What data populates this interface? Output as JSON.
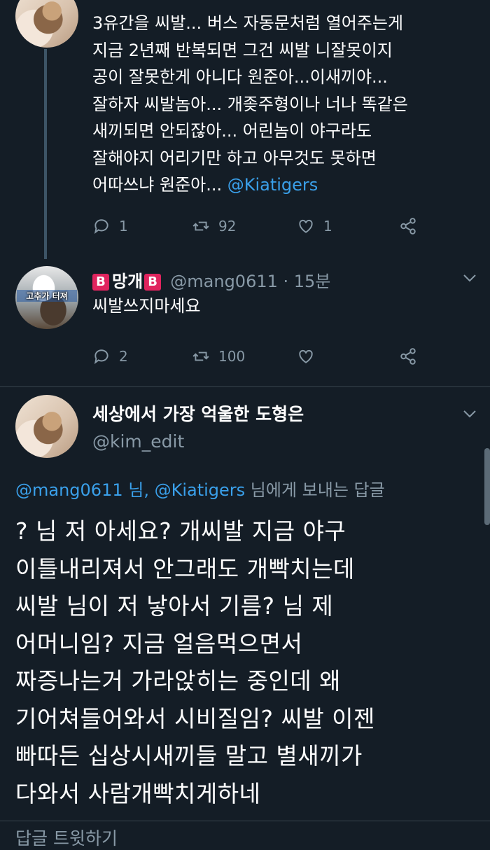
{
  "tweet1": {
    "lines": [
      "3유간을 씨발... 버스 자동문처럼 열어주는게",
      "지금 2년째 반복되면 그건 씨발 니잘못이지",
      "공이 잘못한게 아니다 원준아...이새끼야...",
      "잘하자 씨발놈아... 개좆주형이나 너나 똑같은",
      "새끼되면 안되잖아... 어린놈이 야구라도",
      "잘해야지 어리기만 하고 아무것도 못하면"
    ],
    "last_line_text": "어따쓰냐 원준아... ",
    "last_line_mention": "@Kiatigers",
    "replies": "1",
    "retweets": "92",
    "likes": "1"
  },
  "tweet2": {
    "avatar_text": "고추가 터져",
    "badge_left": "B",
    "display_name": "망개",
    "badge_right": "B",
    "handle_time": "@mang0611 · 15분",
    "text": "씨발쓰지마세요",
    "replies": "2",
    "retweets": "100"
  },
  "main": {
    "display_name": "세상에서 가장 억울한 도형은",
    "handle": "@kim_edit",
    "reply_to_mention1": "@mang0611 님,",
    "reply_to_mention2": "@Kiatigers",
    "reply_to_suffix": " 님에게 보내는 답글",
    "lines": [
      "? 님 저 아세요? 개씨발 지금 야구",
      "이틀내리져서 안그래도 개빡치는데",
      "씨발 님이 저 낳아서 기름? 님 제",
      "어머니임? 지금 얼음먹으면서",
      "짜증나는거 가라앉히는 중인데 왜",
      "기어쳐들어와서 시비질임? 씨발 이젠",
      "빠따든 십상시새끼들 말고 별새끼가",
      "다와서 사람개빡치게하네"
    ]
  },
  "reply_bar": {
    "placeholder": "답글 트윗하기"
  },
  "colors": {
    "background": "#141d26",
    "link": "#3aa0ea",
    "muted": "#8899a6",
    "badge": "#e0245e"
  }
}
